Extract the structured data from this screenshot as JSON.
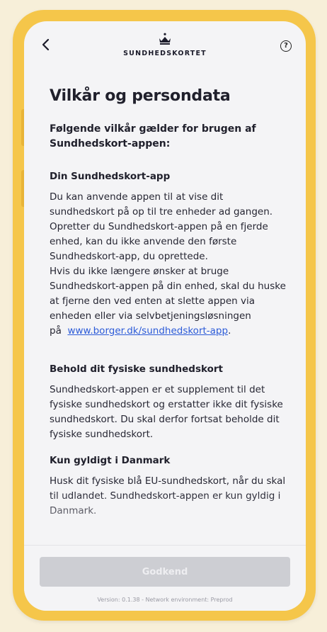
{
  "header": {
    "brand": "SUNDHEDSKORTET",
    "help_glyph": "?",
    "back_icon": "chevron-left-icon",
    "crown_icon": "crown-icon"
  },
  "page": {
    "title": "Vilkår og persondata",
    "intro": "Følgende vilkår gælder for brugen af Sundhedskort-appen:"
  },
  "sections": [
    {
      "heading": "Din Sundhedskort-app",
      "body": "Du kan anvende appen til at vise dit sundhedskort på op til tre enheder ad gangen. Opretter du Sundhedskort-appen på en fjerde enhed, kan du ikke anvende den første Sundhedskort-app, du oprettede.",
      "body2": "Hvis du ikke længere ønsker at bruge Sundhedskort-appen på din enhed, skal du huske at fjerne den ved enten at slette appen via enheden eller via selvbetjeningsløsningen",
      "prefix": "på",
      "link": "www.borger.dk/sundhedskort-app",
      "suffix": "."
    },
    {
      "heading": "Behold dit fysiske sundhedskort",
      "body": "Sundhedskort-appen er et supplement til det fysiske sundhedskort og erstatter ikke dit fysiske sundhedskort. Du skal derfor fortsat beholde dit fysiske sundhedskort."
    },
    {
      "heading": "Kun gyldigt i Danmark",
      "body": "Husk dit fysiske blå EU-sundhedskort, når du skal til udlandet. Sundhedskort-appen er kun gyldig i Danmark."
    }
  ],
  "footer": {
    "approve_label": "Godkend",
    "version": "Version: 0.1.38 - Network environment: Preprod"
  },
  "colors": {
    "frame": "#f5c64a",
    "link": "#2c5bd8",
    "button_disabled": "#cdced3"
  }
}
